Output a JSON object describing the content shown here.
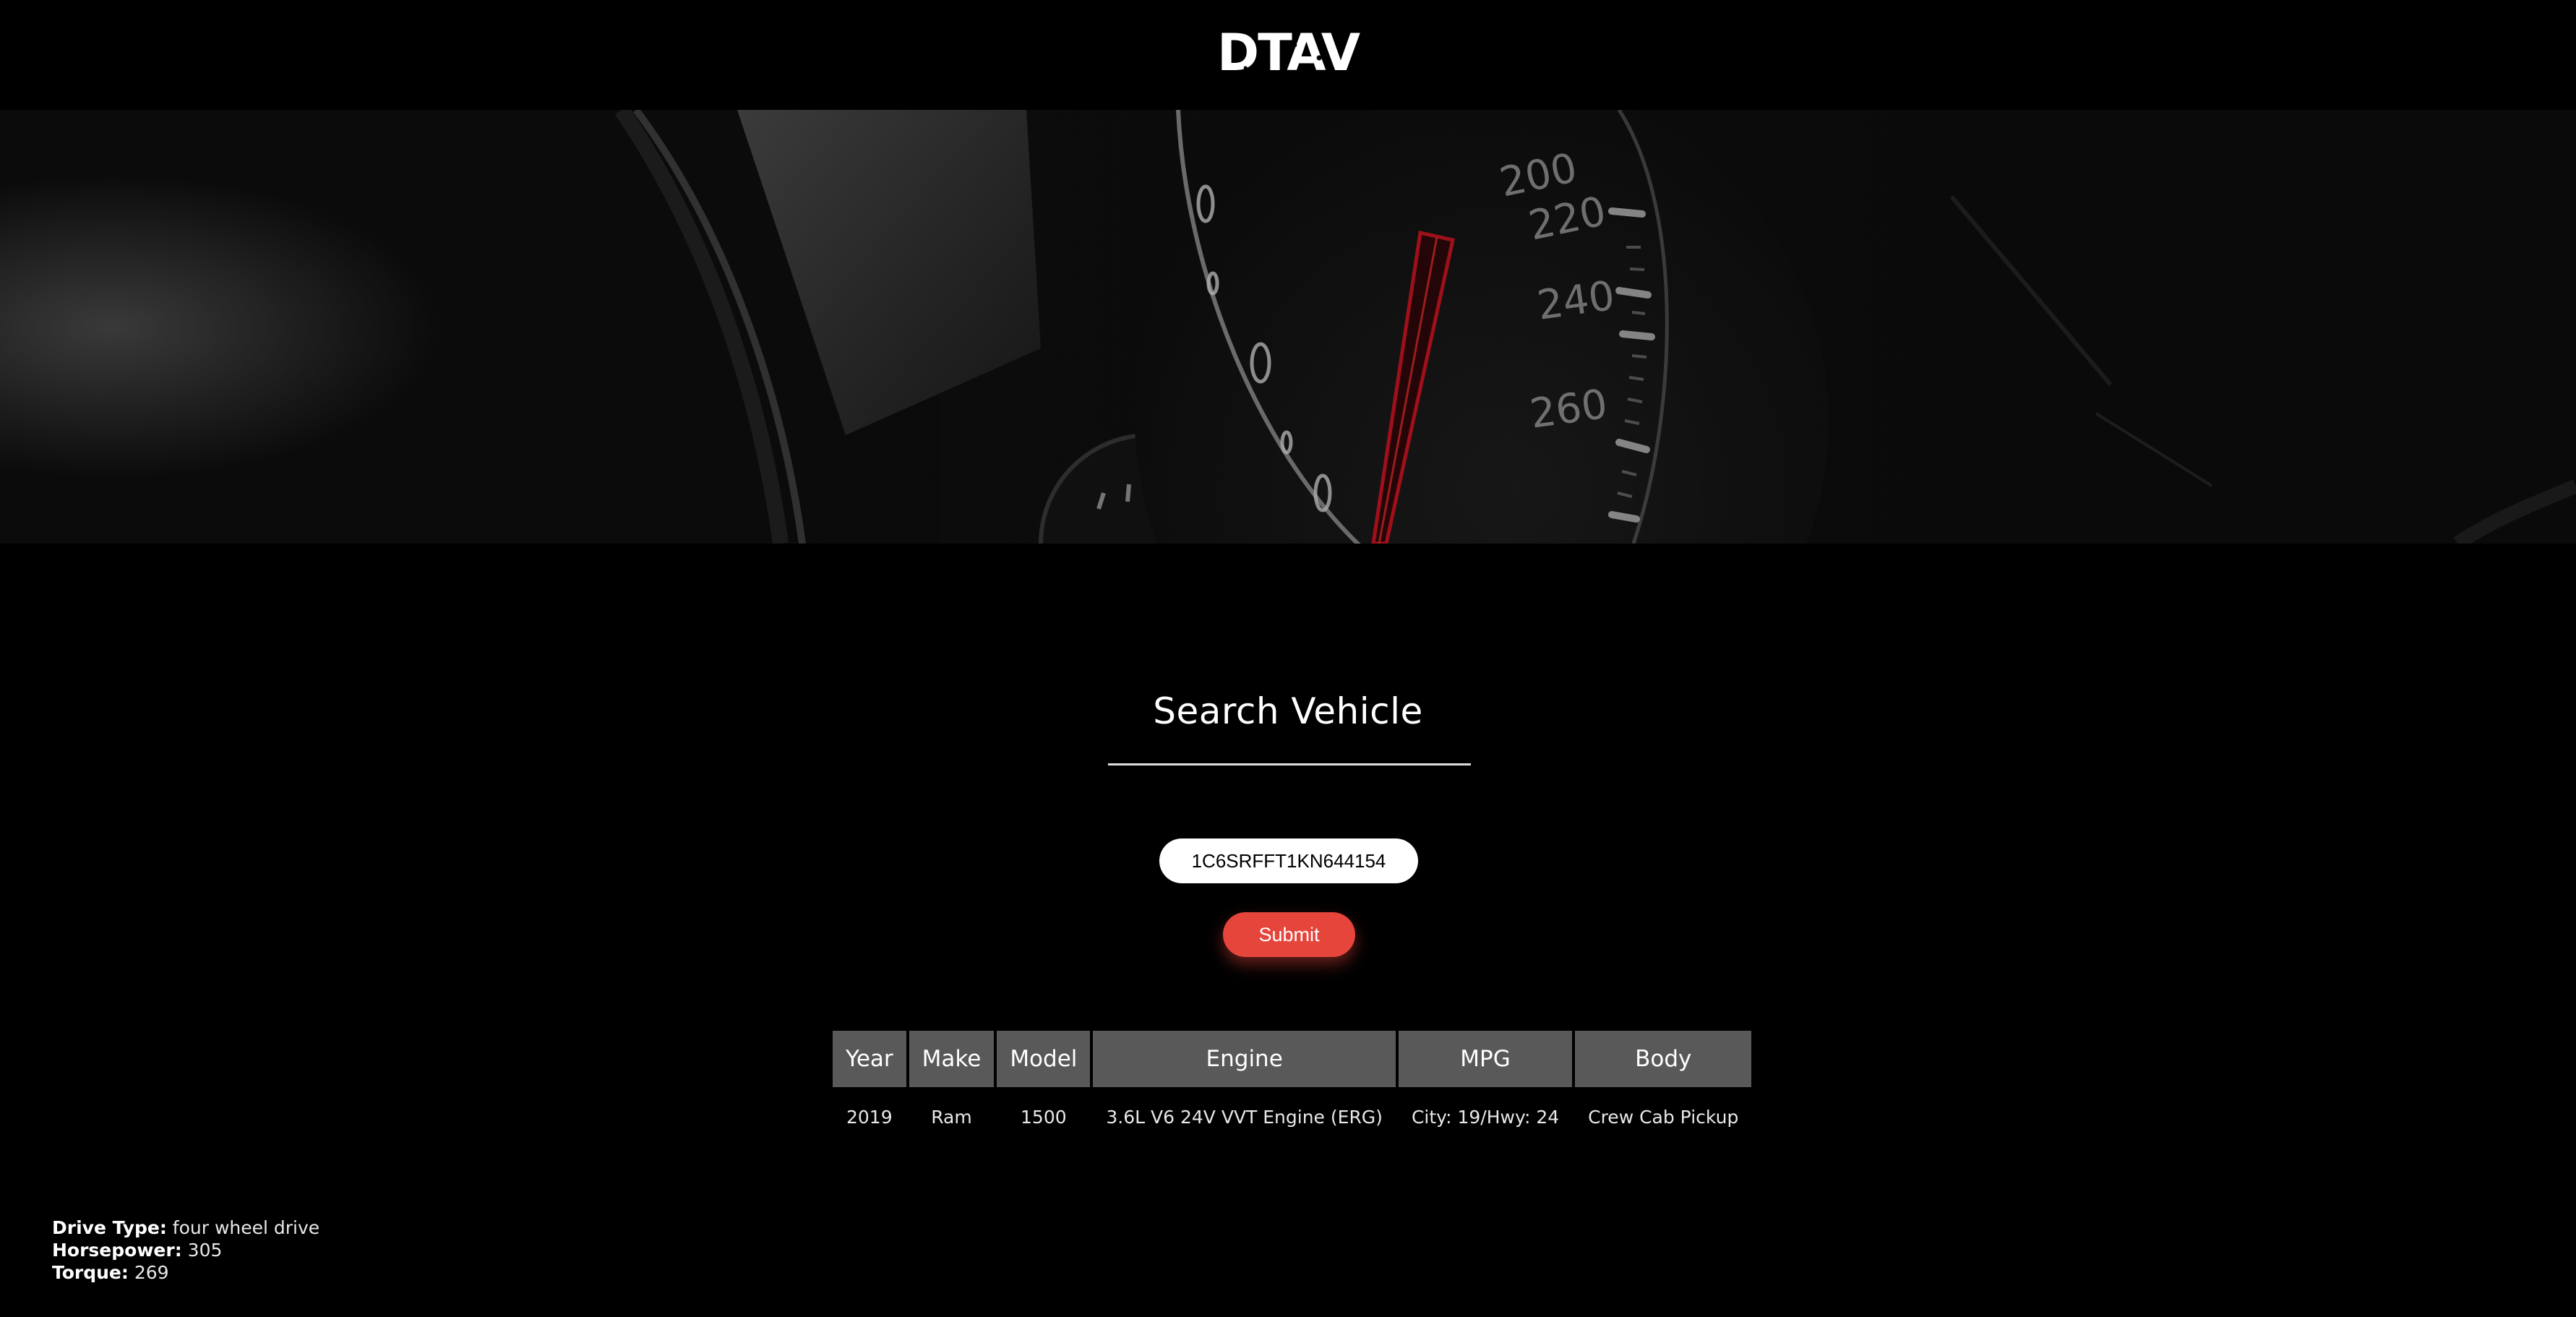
{
  "header": {
    "logo_text": "DTAV"
  },
  "hero": {
    "image": "dashboard-speedometer-icon",
    "gauge_numbers": [
      "200",
      "220",
      "240",
      "260"
    ],
    "accent_color": "#c1121f"
  },
  "search": {
    "title": "Search Vehicle",
    "vin_value": "1C6SRFFT1KN644154",
    "submit_label": "Submit",
    "submit_color": "#e5453b"
  },
  "results": {
    "columns": [
      "Year",
      "Make",
      "Model",
      "Engine",
      "MPG",
      "Body"
    ],
    "row": [
      "2019",
      "Ram",
      "1500",
      "3.6L V6 24V VVT Engine (ERG)",
      "City: 19/Hwy: 24",
      "Crew Cab Pickup"
    ]
  },
  "details": {
    "drive_type_label": "Drive Type:",
    "drive_type_value": "four wheel drive",
    "horsepower_label": "Horsepower:",
    "horsepower_value": "305",
    "torque_label": "Torque:",
    "torque_value": "269"
  }
}
